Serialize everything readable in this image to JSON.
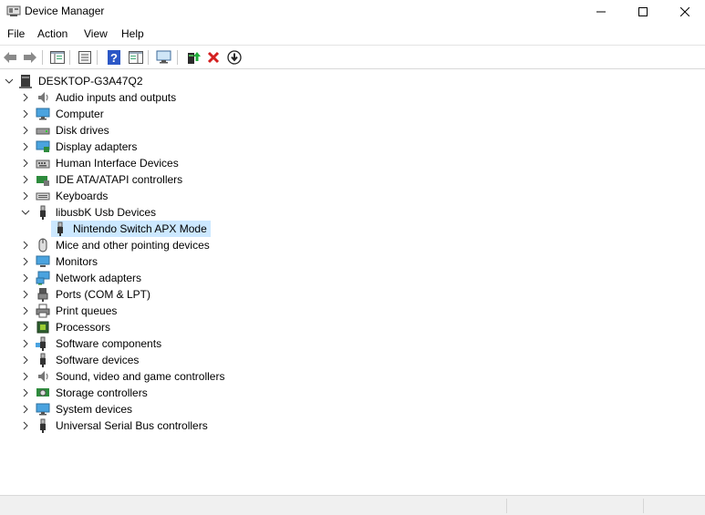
{
  "window": {
    "title": "Device Manager"
  },
  "menu": [
    "File",
    "Action",
    "View",
    "Help"
  ],
  "toolbar": {
    "icons": [
      "back-arrow-icon",
      "forward-arrow-icon",
      "show-hide-console-tree-icon",
      "properties-icon",
      "help-icon",
      "action-pane-icon",
      "scan-hardware-icon",
      "update-driver-icon",
      "uninstall-device-icon",
      "disable-device-icon"
    ]
  },
  "tree": {
    "root": "DESKTOP-G3A47Q2",
    "categories": [
      {
        "label": "Audio inputs and outputs",
        "icon": "speaker-icon",
        "expanded": false
      },
      {
        "label": "Computer",
        "icon": "computer-icon",
        "expanded": false
      },
      {
        "label": "Disk drives",
        "icon": "disk-drive-icon",
        "expanded": false
      },
      {
        "label": "Display adapters",
        "icon": "display-adapter-icon",
        "expanded": false
      },
      {
        "label": "Human Interface Devices",
        "icon": "hid-icon",
        "expanded": false
      },
      {
        "label": "IDE ATA/ATAPI controllers",
        "icon": "ide-controller-icon",
        "expanded": false
      },
      {
        "label": "Keyboards",
        "icon": "keyboard-icon",
        "expanded": false
      },
      {
        "label": "libusbK Usb Devices",
        "icon": "usb-plug-icon",
        "expanded": true,
        "children": [
          {
            "label": "Nintendo Switch APX Mode",
            "icon": "usb-plug-icon",
            "selected": true
          }
        ]
      },
      {
        "label": "Mice and other pointing devices",
        "icon": "mouse-icon",
        "expanded": false
      },
      {
        "label": "Monitors",
        "icon": "monitor-icon",
        "expanded": false
      },
      {
        "label": "Network adapters",
        "icon": "network-adapter-icon",
        "expanded": false
      },
      {
        "label": "Ports (COM & LPT)",
        "icon": "port-icon",
        "expanded": false
      },
      {
        "label": "Print queues",
        "icon": "printer-icon",
        "expanded": false
      },
      {
        "label": "Processors",
        "icon": "processor-icon",
        "expanded": false
      },
      {
        "label": "Software components",
        "icon": "software-component-icon",
        "expanded": false
      },
      {
        "label": "Software devices",
        "icon": "software-device-icon",
        "expanded": false
      },
      {
        "label": "Sound, video and game controllers",
        "icon": "speaker-icon",
        "expanded": false
      },
      {
        "label": "Storage controllers",
        "icon": "storage-controller-icon",
        "expanded": false
      },
      {
        "label": "System devices",
        "icon": "system-device-icon",
        "expanded": false
      },
      {
        "label": "Universal Serial Bus controllers",
        "icon": "usb-plug-icon",
        "expanded": false
      }
    ]
  },
  "colors": {
    "selection": "#cce8ff",
    "delete_red": "#d42020",
    "help_blue": "#2b57c6"
  }
}
